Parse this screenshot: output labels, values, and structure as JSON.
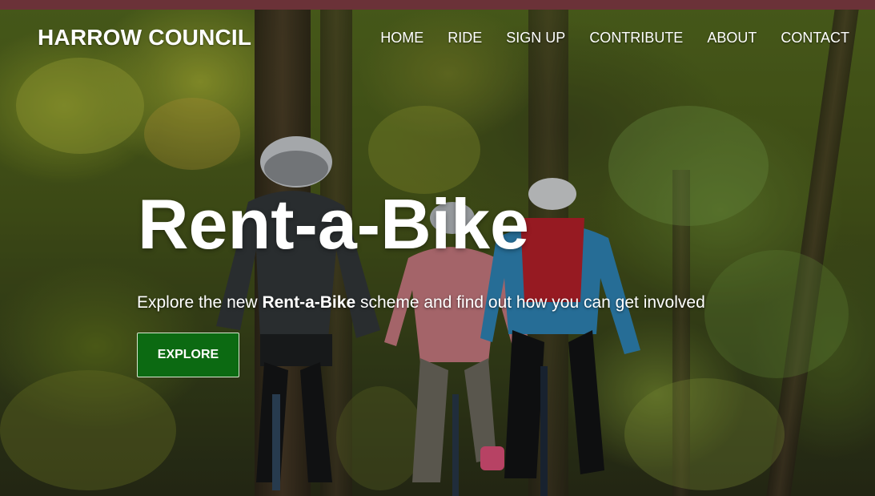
{
  "header": {
    "brand": "HARROW COUNCIL",
    "nav": [
      {
        "label": "HOME"
      },
      {
        "label": "RIDE"
      },
      {
        "label": "SIGN UP"
      },
      {
        "label": "CONTRIBUTE"
      },
      {
        "label": "ABOUT"
      },
      {
        "label": "CONTACT"
      }
    ]
  },
  "hero": {
    "title": "Rent-a-Bike",
    "tagline_pre": "Explore the new ",
    "tagline_bold": "Rent-a-Bike",
    "tagline_post": " scheme and find out how you can get involved",
    "cta_label": "EXPLORE",
    "background": "photo of three cyclists riding through a forest"
  },
  "colors": {
    "topbar": "#6b3238",
    "cta_bg": "#0c6a12",
    "text": "#ffffff"
  }
}
